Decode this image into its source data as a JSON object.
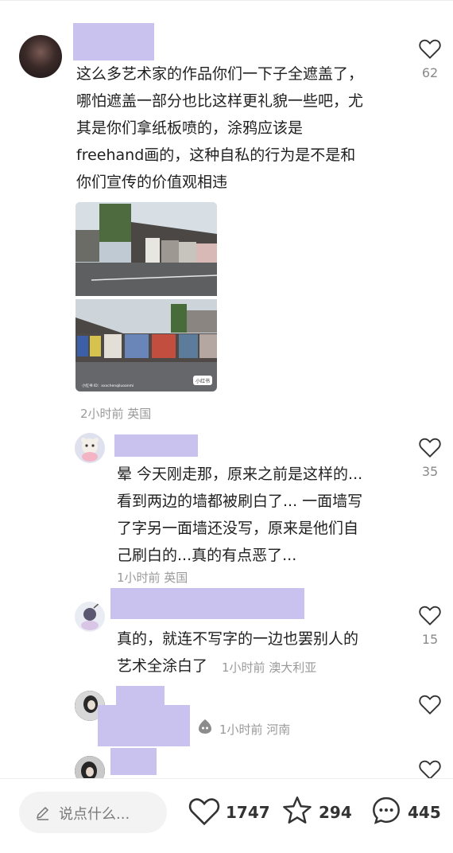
{
  "comments": [
    {
      "lines": [
        "这么多艺术家的作品你们一下子全遮盖了，",
        "哪怕遮盖一部分也比这样更礼貌一些吧，尤",
        "其是你们拿纸板喷的，涂鸦应该是",
        "freehand画的，这种自私的行为是不是和",
        "你们宣传的价值观相违"
      ],
      "meta": "2小时前 英国",
      "likes": "62",
      "image_watermark": "小红书",
      "image_caption": "小红书 ID：xxxchenqiluoanmi"
    },
    {
      "lines": [
        "晕 今天刚走那，原来之前是这样的...",
        "看到两边的墙都被刷白了... 一面墙写",
        "了字另一面墙还没写，原来是他们自",
        "己刷白的...真的有点恶了..."
      ],
      "meta": "1小时前 英国",
      "likes": "35"
    },
    {
      "lines": [
        "真的，就连不写字的一边也罢别人的",
        "艺术全涂白了"
      ],
      "meta": "1小时前 澳大利亚",
      "likes": "15"
    },
    {
      "meta": "1小时前 河南"
    }
  ],
  "bottom_bar": {
    "input_placeholder": "说点什么...",
    "like_count": "1747",
    "star_count": "294",
    "comment_count": "445"
  },
  "colors": {
    "redaction": "#c9c1ee",
    "meta_gray": "#9a9a9a"
  },
  "icons": [
    "heart-icon",
    "star-icon",
    "comment-bubble-icon",
    "pencil-icon",
    "emoji-icon"
  ]
}
